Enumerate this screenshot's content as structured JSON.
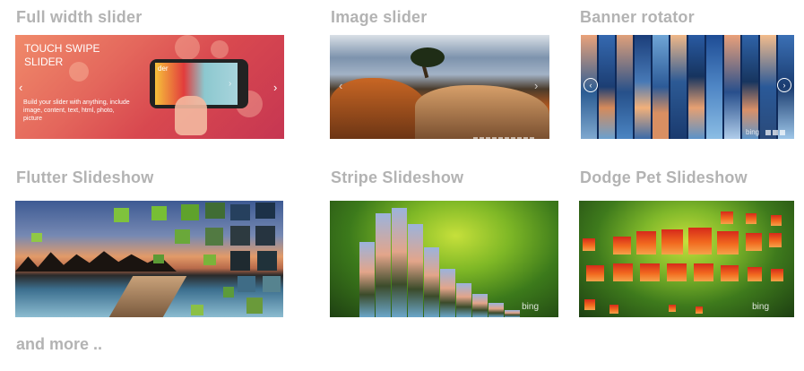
{
  "gallery": {
    "items": [
      {
        "title": "Full width slider"
      },
      {
        "title": "Image slider"
      },
      {
        "title": "Banner rotator"
      },
      {
        "title": "Flutter Slideshow"
      },
      {
        "title": "Stripe Slideshow"
      },
      {
        "title": "Dodge Pet Slideshow"
      }
    ],
    "more_label": "and more .."
  },
  "full_width_slider": {
    "headline": "TOUCH SWIPE SLIDER",
    "body": "Build your slider with anything, include image, content, text, html, photo, picture",
    "screen_label": "der"
  },
  "watermark": "bing",
  "colors": {
    "title_gray": "#b3b3b3",
    "slider_red": "#d8484f",
    "grass_green": "#7fb826",
    "tile_orange": "#f26a1f"
  },
  "icons": {
    "prev": "chevron-left-icon",
    "next": "chevron-right-icon"
  }
}
